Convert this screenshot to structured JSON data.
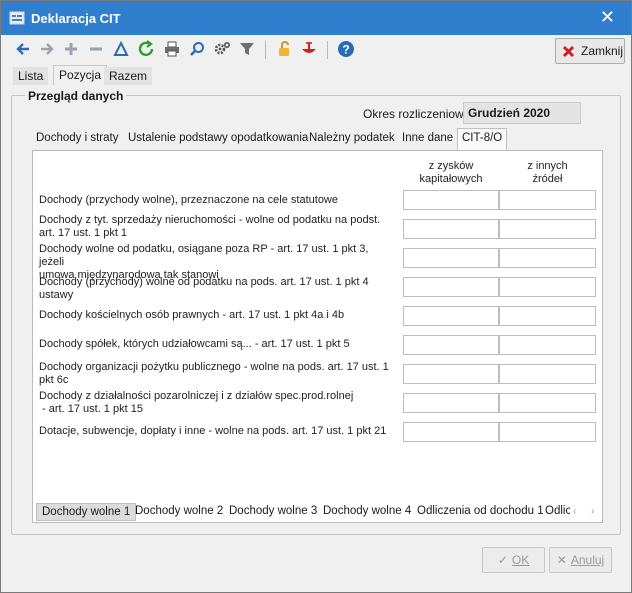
{
  "window": {
    "title": "Deklaracja CIT"
  },
  "toolbar": {
    "close_label": "Zamknij"
  },
  "top_tabs": [
    "Lista",
    "Pozycja",
    "Razem"
  ],
  "group": {
    "title": "Przegląd danych",
    "period_label": "Okres rozliczeniowy",
    "period_value": "Grudzień 2020"
  },
  "inner_tabs": [
    "Dochody i straty",
    "Ustalenie podstawy opodatkowania",
    "Należny podatek",
    "Inne dane",
    "CIT-8/O"
  ],
  "table": {
    "col1_line1": "z zysków",
    "col1_line2": "kapitałowych",
    "col2_line1": "z innych",
    "col2_line2": "źródeł",
    "rows": [
      {
        "l1": "Dochody (przychody wolne), przeznaczone na cele statutowe",
        "l2": ""
      },
      {
        "l1": "Dochody z tyt. sprzedaży nieruchomości  - wolne od podatku na podst.",
        "l2": "art. 17 ust. 1 pkt 1"
      },
      {
        "l1": "Dochody wolne od podatku, osiągane poza RP - art. 17 ust. 1 pkt 3, jeżeli",
        "l2": "umowa międzynarodowa tak stanowi"
      },
      {
        "l1": "Dochody (przychody) wolne od podatku na pods. art. 17 ust. 1 pkt 4",
        "l2": "ustawy"
      },
      {
        "l1": "Dochody kościelnych osób prawnych - art. 17 ust. 1 pkt 4a i 4b",
        "l2": ""
      },
      {
        "l1": "Dochody spółek, których udziałowcami są... - art. 17 ust. 1 pkt 5",
        "l2": ""
      },
      {
        "l1": "Dochody organizacji pożytku publicznego - wolne na pods. art. 17 ust. 1",
        "l2": "pkt 6c"
      },
      {
        "l1": "Dochody z działalności pozarolniczej i z działów spec.prod.rolnej",
        "l2": " - art. 17 ust. 1 pkt 15"
      },
      {
        "l1": "Dotacje, subwencje, dopłaty i inne  - wolne na pods. art. 17 ust. 1 pkt 21",
        "l2": ""
      }
    ]
  },
  "bottom_tabs": [
    "Dochody wolne 1",
    "Dochody wolne 2",
    "Dochody wolne 3",
    "Dochody wolne 4",
    "Odliczenia od dochodu 1",
    "Odlic"
  ],
  "buttons": {
    "ok": "OK",
    "cancel": "Anuluj"
  },
  "colors": {
    "titlebar": "#2f7fce",
    "accent_green": "#2aa02a",
    "accent_red": "#d12020"
  }
}
